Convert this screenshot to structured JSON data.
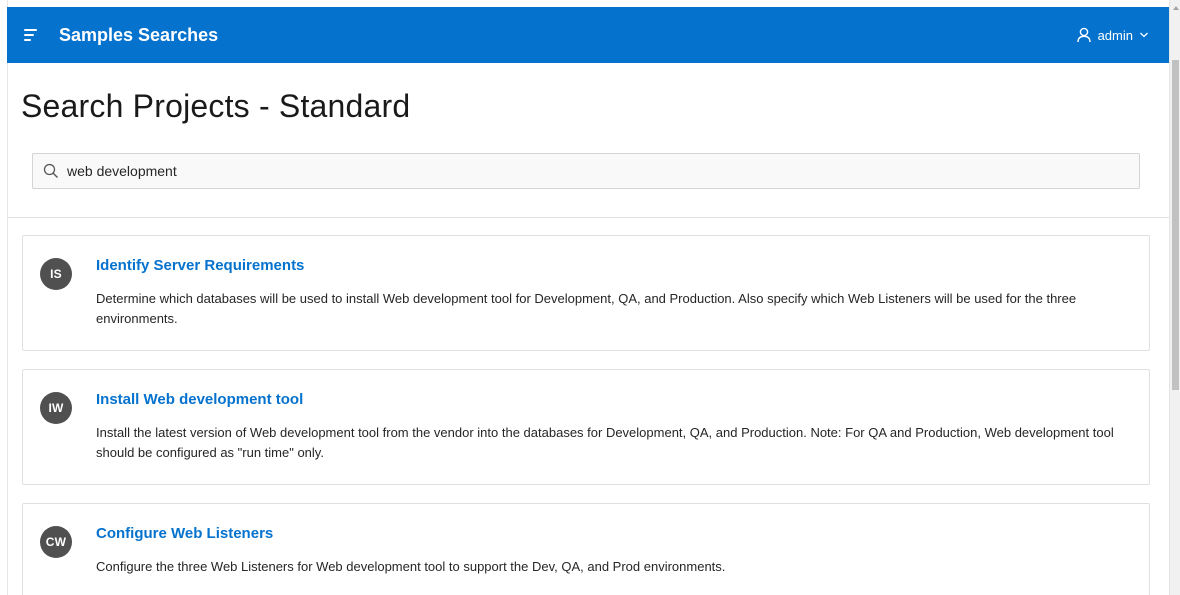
{
  "header": {
    "app_title": "Samples Searches",
    "user_name": "admin",
    "menu_icon": "hamburger-icon",
    "user_icon": "user-icon",
    "dropdown_icon": "chevron-down-icon",
    "background_color": "#0572ce"
  },
  "page": {
    "title": "Search Projects - Standard"
  },
  "search": {
    "value": "web development",
    "icon": "search-icon"
  },
  "results": [
    {
      "initials": "IS",
      "title": "Identify Server Requirements",
      "description": "Determine which databases will be used to install Web development tool for Development, QA, and Production. Also specify which Web Listeners will be used for the three environments."
    },
    {
      "initials": "IW",
      "title": "Install Web development tool",
      "description": "Install the latest version of Web development tool from the vendor into the databases for Development, QA, and Production. Note: For QA and Production, Web development tool should be configured as \"run time\" only."
    },
    {
      "initials": "CW",
      "title": "Configure Web Listeners",
      "description": "Configure the three Web Listeners for Web development tool to support the Dev, QA, and Prod environments."
    }
  ],
  "colors": {
    "link": "#0572ce",
    "avatar": "#505050"
  }
}
